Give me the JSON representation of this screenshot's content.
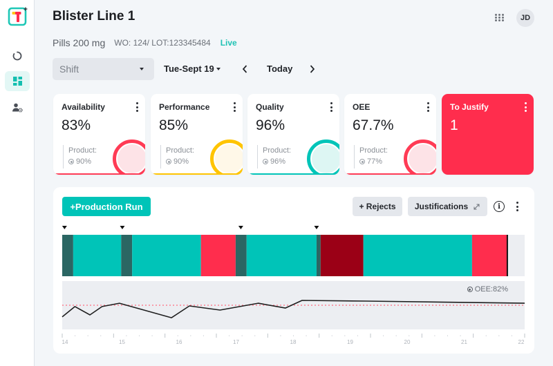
{
  "sidebar": {
    "items": [
      {
        "icon": "loading-circle-icon",
        "active": false
      },
      {
        "icon": "dashboard-icon",
        "active": true
      },
      {
        "icon": "user-settings-icon",
        "active": false
      }
    ]
  },
  "header": {
    "title": "Blister Line 1",
    "product": "Pills 200 mg",
    "work_order": "WO: 124/ LOT:123345484",
    "status": "Live",
    "avatar_initials": "JD"
  },
  "filters": {
    "shift_placeholder": "Shift",
    "date": "Tue-Sept 19",
    "today": "Today"
  },
  "kpis": [
    {
      "title": "Availability",
      "value": "83%",
      "product_label": "Product:",
      "product_value": "90%",
      "color": "#ff3b55",
      "pale": "#fde3e7"
    },
    {
      "title": "Performance",
      "value": "85%",
      "product_label": "Product:",
      "product_value": "90%",
      "color": "#ffc400",
      "pale": "#fff8e8"
    },
    {
      "title": "Quality",
      "value": "96%",
      "product_label": "Product:",
      "product_value": "96%",
      "color": "#00c4b8",
      "pale": "#ddf6f3"
    },
    {
      "title": "OEE",
      "value": "67.7%",
      "product_label": "Product:",
      "product_value": "77%",
      "color": "#ff3b55",
      "pale": "#fde3e7"
    }
  ],
  "justify": {
    "title": "To Justify",
    "value": "1",
    "color": "#ff2d4d"
  },
  "panel": {
    "add_run": "+Production Run",
    "rejects": "+ Rejects",
    "justifications": "Justifications",
    "info": "i"
  },
  "colors": {
    "accent": "#00c4b8",
    "stop": "#ff2d4d",
    "changeover": "#2b6663",
    "unjustified": "#9b0016",
    "future": "#eceef2"
  },
  "chart_data": {
    "type": "line",
    "title": "",
    "xlabel": "",
    "ylabel": "OEE",
    "xlim": [
      14,
      22
    ],
    "ylim": [
      64,
      100
    ],
    "grid": false,
    "x_ticks": [
      14,
      15,
      16,
      17,
      18,
      19,
      20,
      21,
      22
    ],
    "timeline": {
      "state_colors": {
        "changeover": "#2b6663",
        "running": "#00c4b8",
        "stop": "#ff2d4d",
        "unjustified": "#9b0016",
        "future": "#eceef2"
      },
      "segments": [
        {
          "start": 14.0,
          "end": 14.19,
          "state": "changeover"
        },
        {
          "start": 14.19,
          "end": 15.02,
          "state": "running"
        },
        {
          "start": 15.02,
          "end": 15.21,
          "state": "changeover"
        },
        {
          "start": 15.21,
          "end": 16.4,
          "state": "running"
        },
        {
          "start": 16.4,
          "end": 17.0,
          "state": "stop"
        },
        {
          "start": 17.0,
          "end": 17.19,
          "state": "changeover"
        },
        {
          "start": 17.19,
          "end": 18.4,
          "state": "running"
        },
        {
          "start": 18.4,
          "end": 18.47,
          "state": "changeover"
        },
        {
          "start": 18.47,
          "end": 19.21,
          "state": "unjustified"
        },
        {
          "start": 19.21,
          "end": 21.09,
          "state": "running"
        },
        {
          "start": 21.09,
          "end": 21.69,
          "state": "stop"
        },
        {
          "start": 21.69,
          "end": 22.0,
          "state": "future"
        }
      ],
      "run_markers": [
        14.04,
        15.04,
        17.09,
        18.4
      ],
      "now": 21.7
    },
    "series": [
      {
        "name": "OEE",
        "color": "#1e1e1e",
        "x": [
          14.0,
          14.22,
          14.48,
          14.69,
          14.99,
          15.89,
          16.2,
          16.73,
          17.39,
          17.86,
          18.15,
          19.26,
          22.0
        ],
        "y": [
          73.3,
          81.0,
          74.8,
          81.0,
          83.5,
          72.7,
          81.5,
          78.4,
          83.5,
          79.9,
          85.6,
          85.1,
          83.5
        ]
      }
    ],
    "target": {
      "label": "OEE:82%",
      "value": 82,
      "color": "#ff6b80"
    }
  }
}
